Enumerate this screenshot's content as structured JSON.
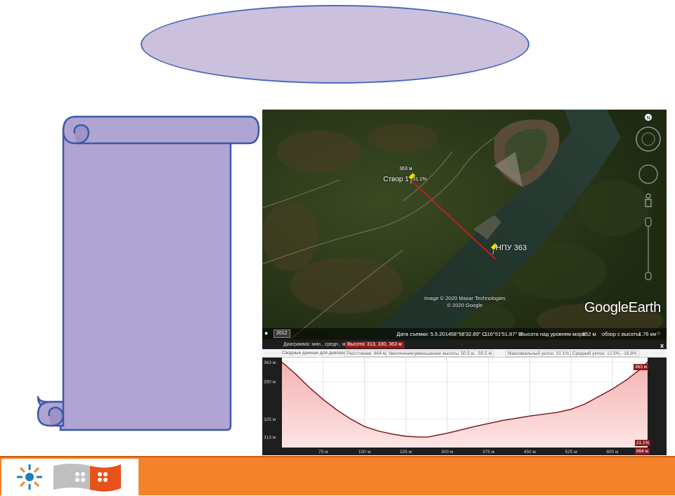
{
  "map": {
    "pin1": {
      "elevation": "363 м",
      "name": "Створ 1",
      "slope": "31.1%"
    },
    "pin2": {
      "name": "НПУ 363"
    },
    "credit": {
      "line1": "Image © 2020 Maxar Technologies",
      "line2": "© 2020 Google"
    },
    "logo": {
      "google": "Google",
      "earth": "Earth"
    },
    "compass": "N"
  },
  "statusbar": {
    "year": "2012",
    "date": "Дата съемки: 5.5.2014",
    "lat": "58°58'32.89\" С",
    "lon": "116°51'51.87\" В",
    "elev_label": "Высота над уровнем моря:",
    "elev_value": "352 м",
    "eye_label": "обзор с высоты",
    "eye_value": "1.76 км"
  },
  "profile": {
    "header_label": "Диаграмма: мин., средн., макс.:",
    "header_value": "Высота: 313, 330, 363 м",
    "close": "x",
    "summary_label": "Сводные данные для диапазона:",
    "distance": "Расстояние: 664 м",
    "gain_loss": "Увеличение/уменьшение высоты: 50.5 м, -50.5 м",
    "max_slope": "Максимальный уклон: 31.1%, -46.8%",
    "avg_slope": "Средний уклон: 12.5%, -18.8%",
    "marker_elev": "363 м",
    "marker_slope": "21.1%",
    "marker_dist": "664 м"
  },
  "colors": {
    "ellipse_fill": "#ccc1dd",
    "ellipse_stroke": "#4a6ab8",
    "scroll_fill": "#b0a4d2",
    "scroll_stroke": "#3b5aa8",
    "footer": "#f4822a",
    "track": "#d11a1a",
    "profile_line": "#7a1010"
  },
  "chart_data": {
    "type": "area",
    "title": "",
    "xlabel": "",
    "ylabel": "",
    "x_unit": "м",
    "y_unit": "м",
    "xlim": [
      0,
      664
    ],
    "ylim": [
      306,
      366
    ],
    "y_ticks": [
      363,
      350,
      325,
      313
    ],
    "y_tick_labels": [
      "363 м",
      "350 м",
      "325 м",
      "313 м"
    ],
    "x_ticks": [
      75,
      150,
      225,
      300,
      375,
      450,
      525,
      600
    ],
    "x_tick_labels": [
      "75 м",
      "150 м",
      "225 м",
      "300 м",
      "375 м",
      "450 м",
      "525 м",
      "600 м"
    ],
    "series": [
      {
        "x": [
          0,
          25,
          50,
          75,
          100,
          125,
          150,
          175,
          200,
          225,
          250,
          265,
          300,
          350,
          400,
          450,
          500,
          525,
          550,
          575,
          600,
          625,
          650,
          664
        ],
        "y": [
          363,
          355,
          346,
          338,
          331,
          325,
          320,
          317,
          315,
          313.5,
          313,
          313,
          315.5,
          320,
          324,
          327,
          329.5,
          331.5,
          335,
          340,
          345,
          351,
          358,
          363
        ]
      }
    ],
    "grid": true
  }
}
